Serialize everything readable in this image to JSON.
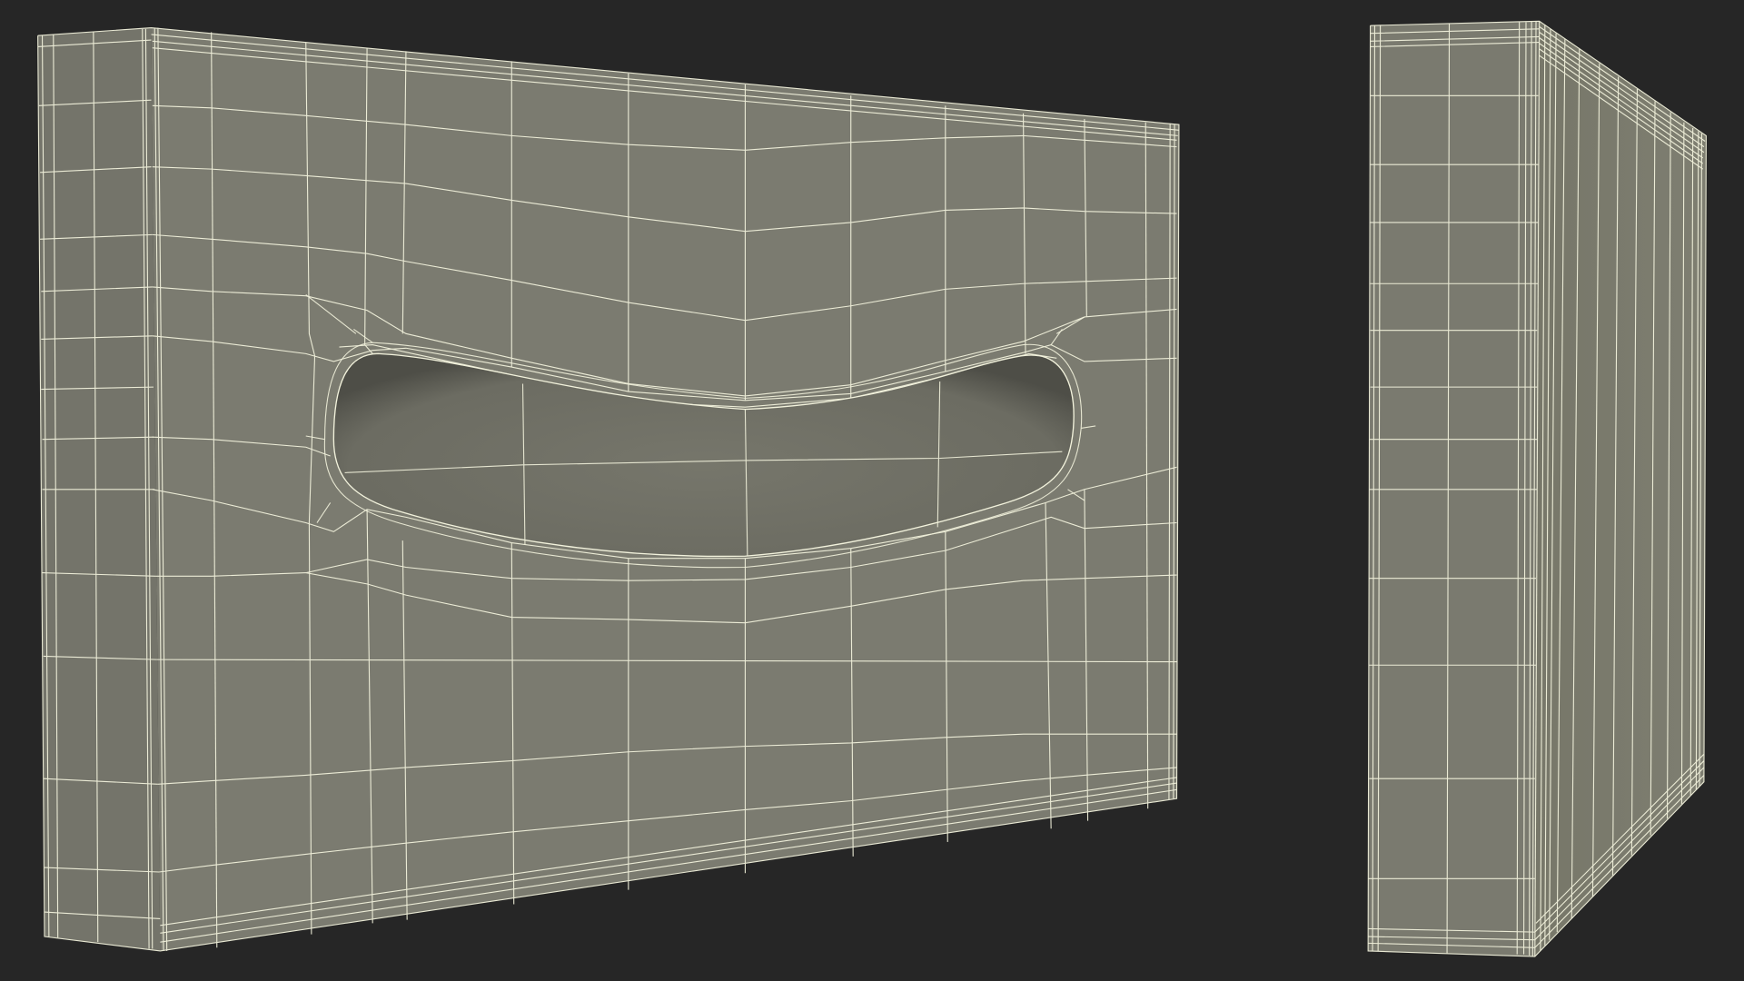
{
  "scene": {
    "background_color": "#262626",
    "surface_color": "#7b7b70",
    "slot_color": "#6f6f65",
    "wire_color": "#f2f2dc",
    "objects": [
      {
        "name": "tissue-box-front-view",
        "feature": "curved-dispensing-slot"
      },
      {
        "name": "tissue-box-side-view",
        "feature": "plain-panel"
      }
    ]
  }
}
